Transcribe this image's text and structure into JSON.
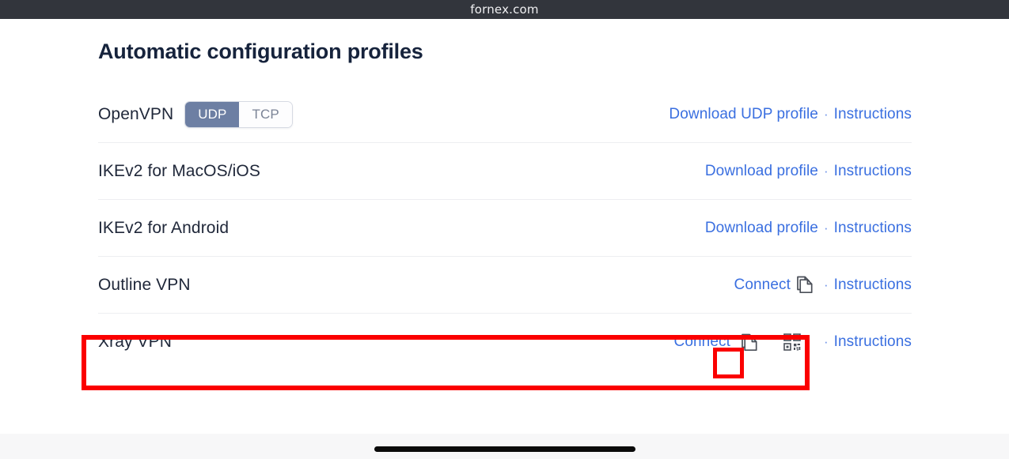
{
  "browser": {
    "url": "fornex.com"
  },
  "card": {
    "title": "Automatic configuration profiles",
    "separator": "·"
  },
  "rows": [
    {
      "id": "openvpn",
      "label": "OpenVPN",
      "toggle": {
        "active": "UDP",
        "inactive": "TCP"
      },
      "download_label": "Download UDP profile",
      "instructions_label": "Instructions"
    },
    {
      "id": "ikev2-macos-ios",
      "label": "IKEv2 for MacOS/iOS",
      "download_label": "Download profile",
      "instructions_label": "Instructions"
    },
    {
      "id": "ikev2-android",
      "label": "IKEv2 for Android",
      "download_label": "Download profile",
      "instructions_label": "Instructions"
    },
    {
      "id": "outline-vpn",
      "label": "Outline VPN",
      "connect_label": "Connect",
      "copy_icon": "copy-icon",
      "instructions_label": "Instructions"
    },
    {
      "id": "xray-vpn",
      "label": "Xray VPN",
      "connect_label": "Connect",
      "copy_icon": "copy-icon",
      "qr_icon": "qr-code-icon",
      "instructions_label": "Instructions",
      "highlighted": true
    }
  ],
  "colors": {
    "link": "#3a6fe0",
    "title": "#16233c",
    "toggle_active_bg": "#6d7fa3",
    "highlight": "#fb0000",
    "browser_bar": "#32353c",
    "page_bg": "#f7f7f8"
  },
  "home_indicator": "home-indicator"
}
